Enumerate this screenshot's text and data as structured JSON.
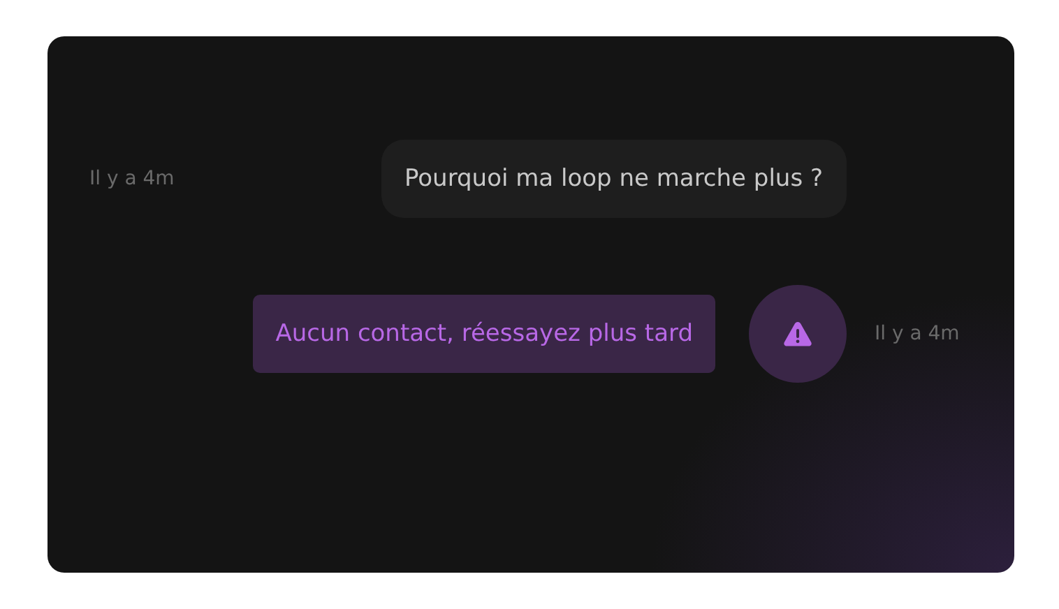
{
  "messages": [
    {
      "kind": "question",
      "text": "Pourquoi ma loop ne marche plus ?",
      "time": "Il y a 4m"
    },
    {
      "kind": "error",
      "text": "Aucun contact, réessayez plus tard",
      "time": "Il y a 4m"
    }
  ]
}
